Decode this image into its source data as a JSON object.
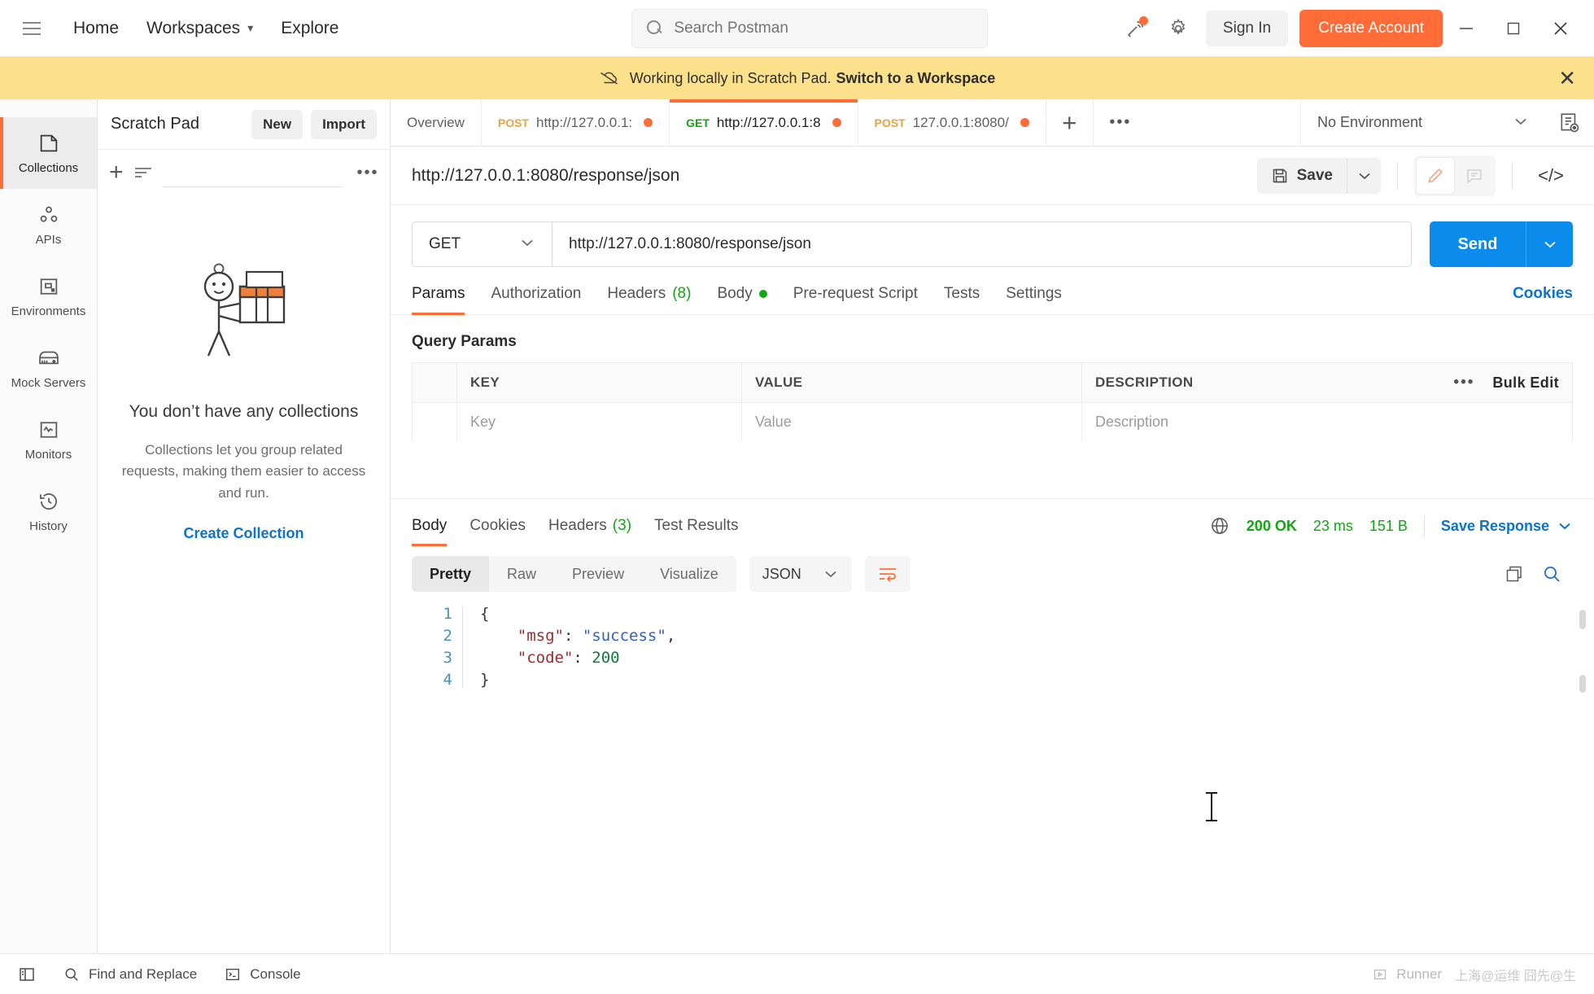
{
  "topbar": {
    "menu_icon": "hamburger-icon",
    "home": "Home",
    "workspaces": "Workspaces",
    "explore": "Explore",
    "search_placeholder": "Search Postman",
    "search_value": "",
    "sign_in": "Sign In",
    "create_account": "Create Account",
    "accent": "#ff6c37"
  },
  "banner": {
    "text": "Working locally in Scratch Pad.",
    "link": "Switch to a Workspace",
    "bg": "#fbe18b"
  },
  "rail": {
    "items": [
      {
        "label": "Collections",
        "icon": "collections-icon",
        "active": true
      },
      {
        "label": "APIs",
        "icon": "apis-icon",
        "active": false
      },
      {
        "label": "Environments",
        "icon": "environments-icon",
        "active": false
      },
      {
        "label": "Mock Servers",
        "icon": "mock-servers-icon",
        "active": false
      },
      {
        "label": "Monitors",
        "icon": "monitors-icon",
        "active": false
      },
      {
        "label": "History",
        "icon": "history-icon",
        "active": false
      }
    ]
  },
  "sidebar": {
    "title": "Scratch Pad",
    "new_label": "New",
    "import_label": "Import",
    "filter_placeholder": "",
    "empty": {
      "heading": "You don’t have any collections",
      "body": "Collections let you group related requests, making them easier to access and run.",
      "cta": "Create Collection"
    }
  },
  "tabs": [
    {
      "label": "Overview",
      "method": "",
      "active": false,
      "unsaved": false
    },
    {
      "label": "http://127.0.0.1:",
      "method": "POST",
      "active": false,
      "unsaved": true
    },
    {
      "label": "http://127.0.0.1:8",
      "method": "GET",
      "active": true,
      "unsaved": true
    },
    {
      "label": "127.0.0.1:8080/",
      "method": "POST",
      "active": false,
      "unsaved": true
    }
  ],
  "environment": {
    "selected": "No Environment"
  },
  "request": {
    "title": "http://127.0.0.1:8080/response/json",
    "save_label": "Save",
    "method": "GET",
    "url": "http://127.0.0.1:8080/response/json",
    "send_label": "Send",
    "tabs": [
      {
        "label": "Params",
        "active": true
      },
      {
        "label": "Authorization",
        "active": false
      },
      {
        "label": "Headers",
        "count": "(8)",
        "active": false
      },
      {
        "label": "Body",
        "dot": true,
        "active": false
      },
      {
        "label": "Pre-request Script",
        "active": false
      },
      {
        "label": "Tests",
        "active": false
      },
      {
        "label": "Settings",
        "active": false
      }
    ],
    "cookies_link": "Cookies",
    "query_params": {
      "section_title": "Query Params",
      "columns": [
        "KEY",
        "VALUE",
        "DESCRIPTION"
      ],
      "bulk_edit": "Bulk Edit",
      "rows": [
        {
          "key": "",
          "value": "",
          "description": "",
          "key_ph": "Key",
          "value_ph": "Value",
          "desc_ph": "Description"
        }
      ]
    }
  },
  "response": {
    "tabs": [
      {
        "label": "Body",
        "active": true
      },
      {
        "label": "Cookies",
        "active": false
      },
      {
        "label": "Headers",
        "count": "(3)",
        "active": false
      },
      {
        "label": "Test Results",
        "active": false
      }
    ],
    "status": "200 OK",
    "time": "23 ms",
    "size": "151 B",
    "save_response": "Save Response",
    "viewer": {
      "modes": [
        {
          "label": "Pretty",
          "active": true
        },
        {
          "label": "Raw",
          "active": false
        },
        {
          "label": "Preview",
          "active": false
        },
        {
          "label": "Visualize",
          "active": false
        }
      ],
      "format": "JSON",
      "wrap_icon": "wrap-lines-icon",
      "copy_icon": "copy-icon",
      "search_icon": "search-icon"
    },
    "body_lines": [
      {
        "n": "1",
        "tokens": [
          {
            "t": "{",
            "c": "p"
          }
        ]
      },
      {
        "n": "2",
        "tokens": [
          {
            "t": "    ",
            "c": "p"
          },
          {
            "t": "\"msg\"",
            "c": "k"
          },
          {
            "t": ": ",
            "c": "p"
          },
          {
            "t": "\"success\"",
            "c": "s"
          },
          {
            "t": ",",
            "c": "p"
          }
        ]
      },
      {
        "n": "3",
        "tokens": [
          {
            "t": "    ",
            "c": "p"
          },
          {
            "t": "\"code\"",
            "c": "k"
          },
          {
            "t": ": ",
            "c": "p"
          },
          {
            "t": "200",
            "c": "n"
          }
        ]
      },
      {
        "n": "4",
        "tokens": [
          {
            "t": "}",
            "c": "p"
          }
        ]
      }
    ]
  },
  "footer": {
    "sidebar_toggle": "sidebar-toggle-icon",
    "find_replace": "Find and Replace",
    "console": "Console",
    "runner": "Runner",
    "watermark": "上海@运维 囧先@生"
  }
}
